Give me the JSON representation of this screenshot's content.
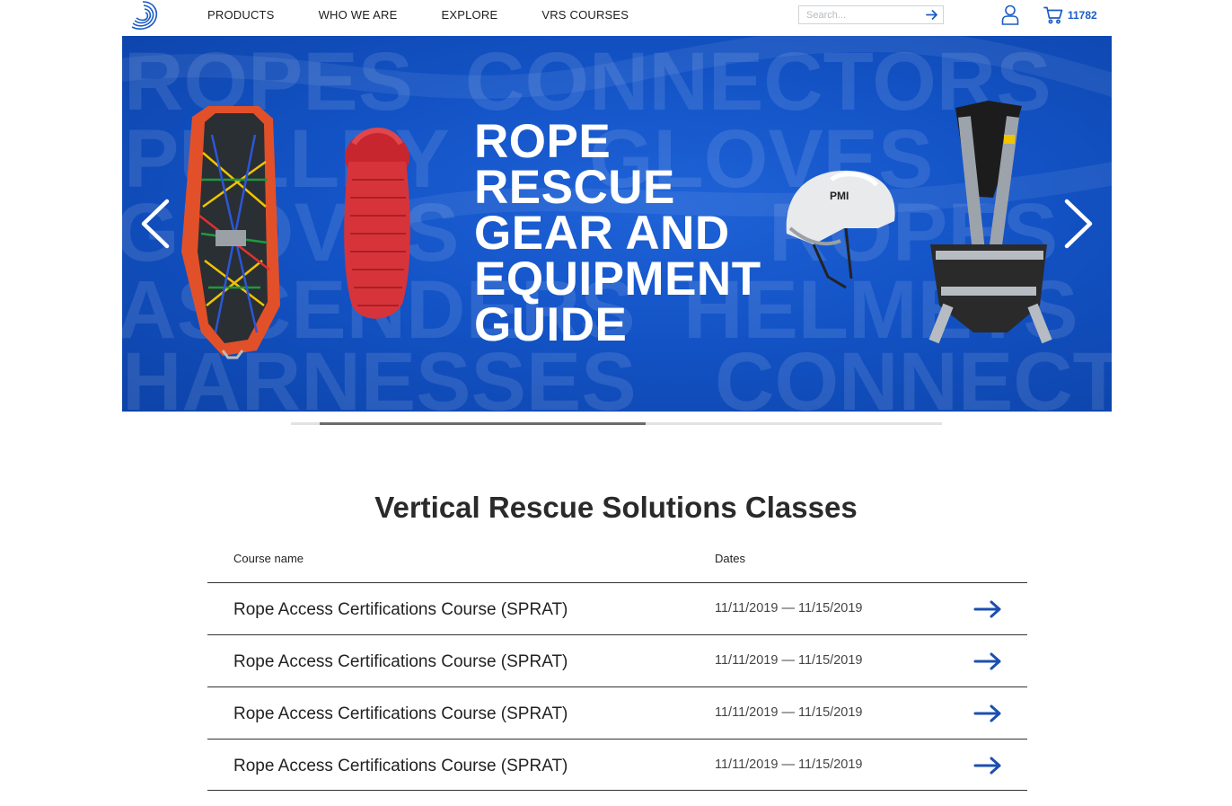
{
  "header": {
    "nav": [
      "PRODUCTS",
      "WHO WE ARE",
      "EXPLORE",
      "VRS COURSES"
    ],
    "search_placeholder": "Search...",
    "cart_count": "11782",
    "icons": {
      "logo": "brand-swirl-logo",
      "search_submit": "arrow-right-icon",
      "account": "user-icon",
      "cart": "cart-icon"
    }
  },
  "hero": {
    "title_lines": [
      "ROPE",
      "RESCUE",
      "GEAR AND",
      "EQUIPMENT",
      "GUIDE"
    ],
    "background_words": [
      "ROPES",
      "CONNECTORS",
      "PULLEY",
      "GLOVES",
      "GLOVES",
      "ROPES",
      "ASCENDERS",
      "HELMETS",
      "HARNESSES",
      "CONNECT"
    ],
    "products": [
      "rescue-basket",
      "coiled-rope",
      "helmet",
      "harness"
    ],
    "helmet_brand": "PMI",
    "colors": {
      "background": "#1353c6",
      "title": "#ffffff"
    }
  },
  "carousel": {
    "progress": 0.5
  },
  "classes": {
    "title": "Vertical Rescue Solutions Classes",
    "columns": {
      "name": "Course name",
      "dates": "Dates"
    },
    "rows": [
      {
        "name": "Rope Access Certifications Course (SPRAT)",
        "dates": "11/11/2019 — 11/15/2019"
      },
      {
        "name": "Rope Access Certifications Course (SPRAT)",
        "dates": "11/11/2019 — 11/15/2019"
      },
      {
        "name": "Rope Access Certifications Course (SPRAT)",
        "dates": "11/11/2019 — 11/15/2019"
      },
      {
        "name": "Rope Access Certifications Course (SPRAT)",
        "dates": "11/11/2019 — 11/15/2019"
      }
    ],
    "accent_color": "#1b4fb0"
  }
}
